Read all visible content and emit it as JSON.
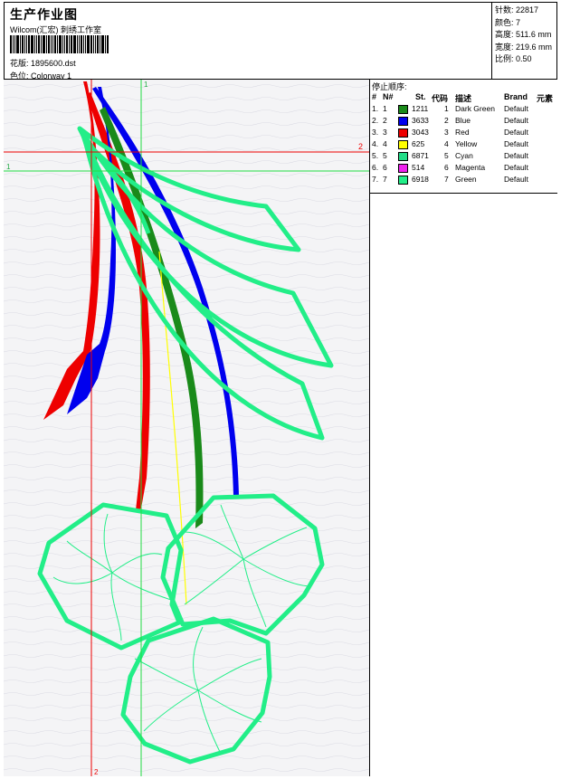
{
  "header": {
    "title": "生产作业图",
    "company": "Wilcom(汇宏) 刺绣工作室",
    "design_label": "花版:",
    "design_name": "1895600.dst",
    "colorway_label": "色位:",
    "colorway_name": "Colorway 1"
  },
  "stats": {
    "stitches": "针数: 22817",
    "colors": "颜色: 7",
    "height": "高度: 511.6 mm",
    "width": "宽度: 219.6 mm",
    "scale": "比例: 0.50"
  },
  "guides": {
    "v1_label": "1",
    "v2_label": "2",
    "h1_label": "1",
    "h2_label": "2"
  },
  "stop_sequence": {
    "title": "停止顺序:",
    "headers": {
      "num": "#",
      "n": "N#",
      "st": "St.",
      "code": "代码",
      "desc": "描述",
      "brand": "Brand",
      "elem": "元素"
    },
    "rows": [
      {
        "num": "1.",
        "n": "1",
        "color": "#1a8a1a",
        "st": "1211",
        "code": "1",
        "desc": "Dark Green",
        "brand": "Default"
      },
      {
        "num": "2.",
        "n": "2",
        "color": "#0000ee",
        "st": "3633",
        "code": "2",
        "desc": "Blue",
        "brand": "Default"
      },
      {
        "num": "3.",
        "n": "3",
        "color": "#ee0000",
        "st": "3043",
        "code": "3",
        "desc": "Red",
        "brand": "Default"
      },
      {
        "num": "4.",
        "n": "4",
        "color": "#ffff00",
        "st": "625",
        "code": "4",
        "desc": "Yellow",
        "brand": "Default"
      },
      {
        "num": "5.",
        "n": "5",
        "color": "#22dd88",
        "st": "6871",
        "code": "5",
        "desc": "Cyan",
        "brand": "Default"
      },
      {
        "num": "6.",
        "n": "6",
        "color": "#ee22ee",
        "st": "514",
        "code": "6",
        "desc": "Magenta",
        "brand": "Default"
      },
      {
        "num": "7.",
        "n": "7",
        "color": "#22ee88",
        "st": "6918",
        "code": "7",
        "desc": "Green",
        "brand": "Default"
      }
    ]
  },
  "colors": {
    "red": "#ee0000",
    "blue": "#0000ee",
    "dark_green": "#1a8a1a",
    "green": "#22ee88",
    "yellow": "#ffff00",
    "guide_red": "#ee0000",
    "guide_green": "#22dd44"
  }
}
